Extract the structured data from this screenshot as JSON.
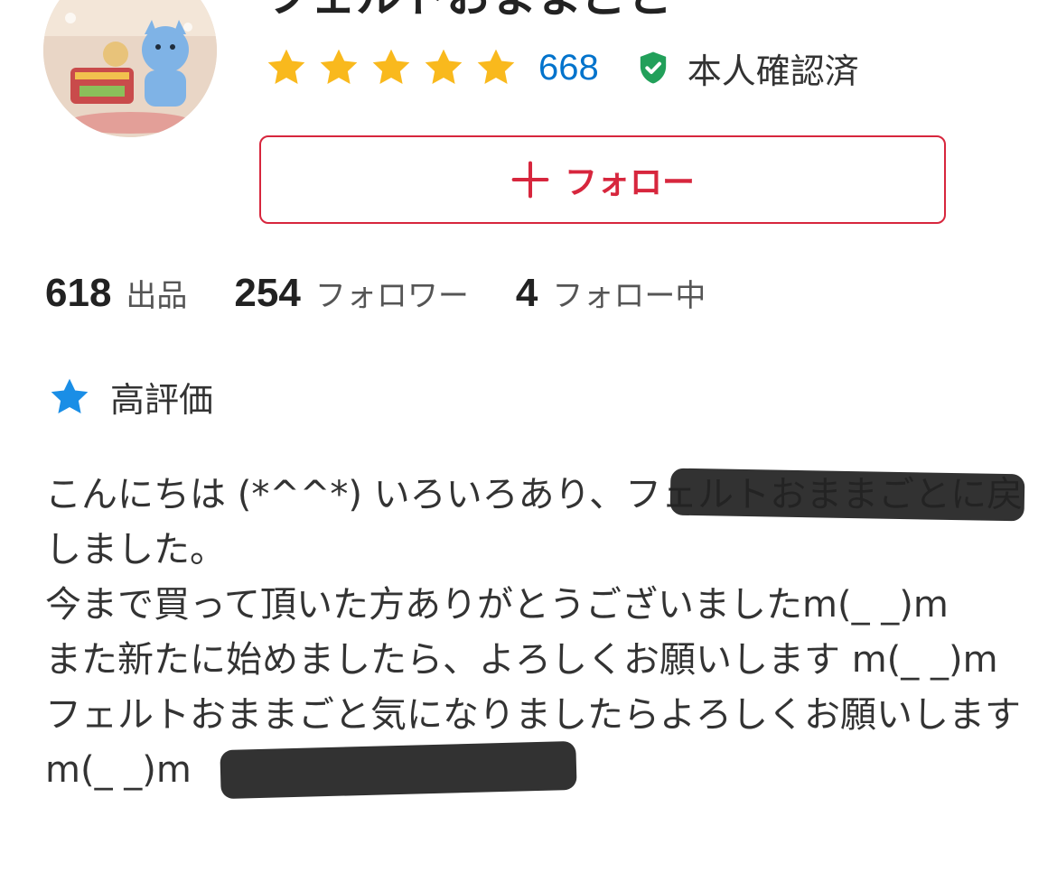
{
  "profile": {
    "name": "フェルトおままごと",
    "rating": 5,
    "review_count": "668",
    "verified_label": "本人確認済",
    "avatar_icon": "shop-avatar-image"
  },
  "follow_button": {
    "label": "フォロー",
    "icon": "plus-icon"
  },
  "stats": {
    "listings_count": "618",
    "listings_label": "出品",
    "followers_count": "254",
    "followers_label": "フォロワー",
    "following_count": "4",
    "following_label": "フォロー中"
  },
  "badge": {
    "icon": "star-icon",
    "label": "高評価"
  },
  "bio": {
    "text": "こんにちは (*^^*) いろいろあり、フェルトおままごとに戻しました。\n今まで買って頂いた方ありがとうございましたm(_ _)m\nまた新たに始めましたら、よろしくお願いします m(_ _)mフェルトおままごと気になりましたらよろしくお願いしますm(_ _)m"
  },
  "colors": {
    "accent_red": "#d7263d",
    "link_blue": "#0073cc",
    "star_gold": "#f9b91d",
    "verified_green": "#22a05a",
    "badge_blue": "#1a8ee6"
  }
}
